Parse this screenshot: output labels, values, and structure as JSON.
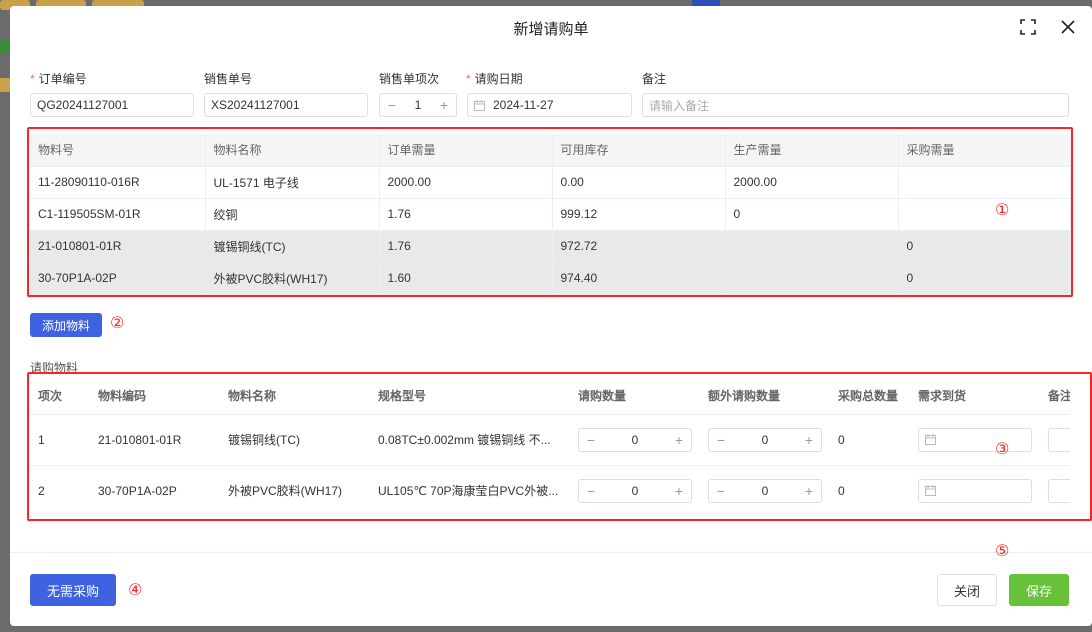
{
  "dialog": {
    "title": "新增请购单"
  },
  "form": {
    "order_no": {
      "label": "订单编号",
      "value": "QG20241127001"
    },
    "sales_order_no": {
      "label": "销售单号",
      "value": "XS20241127001"
    },
    "sales_item_no": {
      "label": "销售单项次",
      "value": "1"
    },
    "request_date": {
      "label": "请购日期",
      "value": "2024-11-27"
    },
    "remark": {
      "label": "备注",
      "placeholder": "请输入备注"
    }
  },
  "materials_table": {
    "headers": [
      "物料号",
      "物料名称",
      "订单需量",
      "可用库存",
      "生产需量",
      "采购需量"
    ],
    "rows": [
      [
        "11-28090110-016R",
        "UL-1571 电子线",
        "2000.00",
        "0.00",
        "2000.00",
        ""
      ],
      [
        "C1-119505SM-01R",
        "绞铜",
        "1.76",
        "999.12",
        "0",
        ""
      ],
      [
        "21-010801-01R",
        "镀锡铜线(TC)",
        "1.76",
        "972.72",
        "",
        "0"
      ],
      [
        "30-70P1A-02P",
        "外被PVC胶料(WH17)",
        "1.60",
        "974.40",
        "",
        "0"
      ]
    ]
  },
  "add_material_button": "添加物料",
  "purchase_section_label": "请购物料",
  "purchase_table": {
    "headers": [
      "项次",
      "物料编码",
      "物料名称",
      "规格型号",
      "请购数量",
      "额外请购数量",
      "采购总数量",
      "需求到货",
      "备注"
    ],
    "rows": [
      {
        "item": "1",
        "code": "21-010801-01R",
        "name": "镀锡铜线(TC)",
        "spec": "0.08TC±0.002mm 镀锡铜线 不...",
        "qty": "0",
        "extra_qty": "0",
        "total": "0"
      },
      {
        "item": "2",
        "code": "30-70P1A-02P",
        "name": "外被PVC胶料(WH17)",
        "spec": "UL105℃ 70P海康莹白PVC外被...",
        "qty": "0",
        "extra_qty": "0",
        "total": "0"
      }
    ]
  },
  "footer": {
    "no_purchase_button": "无需采购",
    "close_button": "关闭",
    "save_button": "保存"
  },
  "annotations": [
    "①",
    "②",
    "③",
    "④",
    "⑤"
  ],
  "colors": {
    "primary": "#3f63e0",
    "success": "#67c23a",
    "annotation_red": "#ff2222"
  }
}
